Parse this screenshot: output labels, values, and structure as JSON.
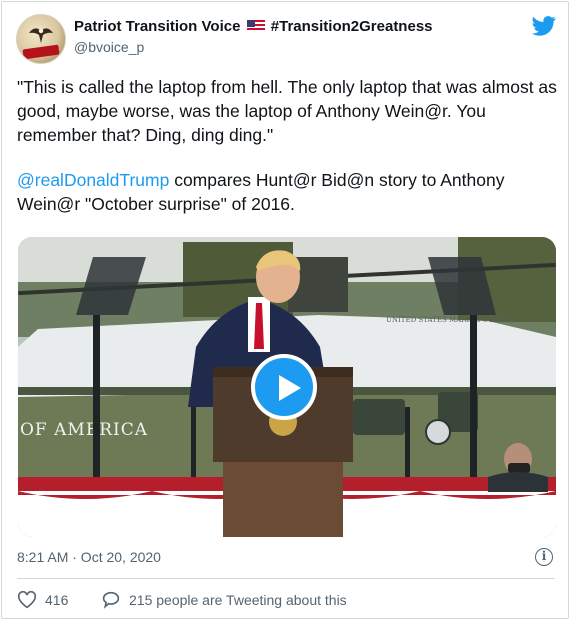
{
  "tweet": {
    "author_name": "Patriot Transition Voice",
    "author_hashtag": "#Transition2Greatness",
    "handle": "@bvoice_p",
    "quote": "\"This is called the laptop from hell. The only laptop that was almost as good, maybe worse, was the laptop of Anthony Wein@r. You remember that? Ding, ding ding.\"",
    "mention": "@realDonaldTrump",
    "body_line_2": " compares Hunt@r Bid@n story to Anthony Wein@r \"October surprise\" of 2016.",
    "timestamp": "8:21 AM · Oct 20, 2020",
    "like_count": "416",
    "reply_text": "215 people are Tweeting about this",
    "video_sign_text": "OF AMERICA",
    "video_heli_text": "UNITED STATES MARINE CORPS"
  },
  "icons": {
    "brand": "twitter-bird-icon",
    "flag": "us-flag-icon",
    "play": "play-icon",
    "info": "info-icon",
    "like": "heart-icon",
    "reply": "speech-bubble-icon"
  },
  "colors": {
    "accent": "#1d9bf0",
    "text": "#0f1419",
    "muted": "#536471",
    "border": "#cfd9de"
  }
}
